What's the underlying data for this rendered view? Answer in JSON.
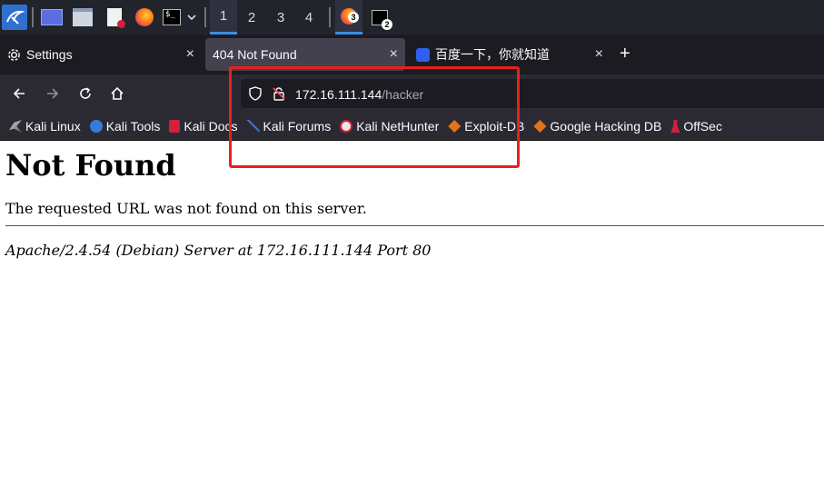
{
  "taskbar": {
    "workspaces": [
      "1",
      "2",
      "3",
      "4"
    ],
    "active_workspace": "1",
    "firefox_badge": "3",
    "terminal_badge": "2"
  },
  "tabs": [
    {
      "label": "Settings",
      "icon": "gear-icon"
    },
    {
      "label": "404 Not Found",
      "active": true
    },
    {
      "label": "百度一下，你就知道",
      "icon": "baidu-paw-icon"
    }
  ],
  "url": {
    "host": "172.16.111.144",
    "path": "/hacker"
  },
  "bookmarks": [
    {
      "label": "Kali Linux",
      "icon": "kali-dragon-icon"
    },
    {
      "label": "Kali Tools",
      "icon": "kali-tools-icon"
    },
    {
      "label": "Kali Docs",
      "icon": "kali-docs-icon"
    },
    {
      "label": "Kali Forums",
      "icon": "kali-forums-icon"
    },
    {
      "label": "Kali NetHunter",
      "icon": "nethunter-icon"
    },
    {
      "label": "Exploit-DB",
      "icon": "exploit-db-icon"
    },
    {
      "label": "Google Hacking DB",
      "icon": "ghdb-icon"
    },
    {
      "label": "OffSec",
      "icon": "offsec-icon"
    }
  ],
  "page": {
    "heading": "Not Found",
    "message": "The requested URL was not found on this server.",
    "signature": "Apache/2.4.54 (Debian) Server at 172.16.111.144 Port 80"
  },
  "colors": {
    "highlight_box": "#e8201e",
    "taskbar_bg": "#22242c",
    "tab_active_bg": "#42414d",
    "accent": "#3a8ee6"
  }
}
